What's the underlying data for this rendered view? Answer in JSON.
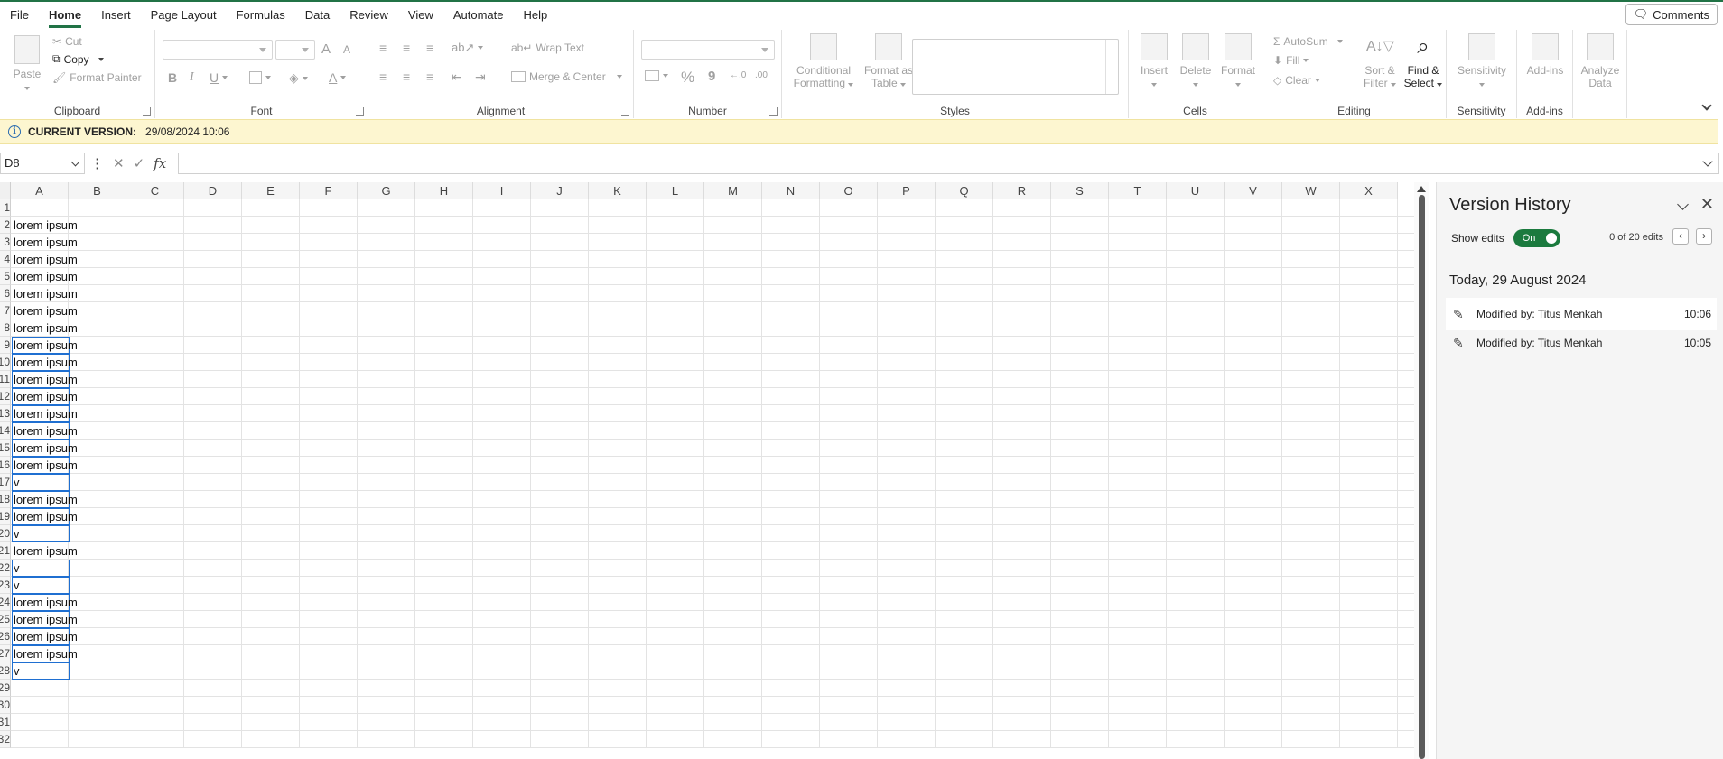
{
  "menu": {
    "tabs": [
      "File",
      "Home",
      "Insert",
      "Page Layout",
      "Formulas",
      "Data",
      "Review",
      "View",
      "Automate",
      "Help"
    ],
    "active": "Home",
    "comments_label": "Comments"
  },
  "ribbon": {
    "clipboard": {
      "paste": "Paste",
      "cut": "Cut",
      "copy": "Copy",
      "format_painter": "Format Painter",
      "label": "Clipboard"
    },
    "font": {
      "bold": "B",
      "italic": "I",
      "underline": "U",
      "grow": "A",
      "shrink": "A",
      "label": "Font"
    },
    "alignment": {
      "wrap_text": "Wrap Text",
      "merge_center": "Merge & Center",
      "label": "Alignment"
    },
    "number": {
      "percent": "%",
      "comma": "9",
      "label": "Number"
    },
    "styles": {
      "conditional": "Conditional",
      "formatting": "Formatting",
      "format_as": "Format as",
      "table": "Table",
      "label": "Styles"
    },
    "cells": {
      "insert": "Insert",
      "delete": "Delete",
      "format": "Format",
      "label": "Cells"
    },
    "editing": {
      "autosum": "AutoSum",
      "fill": "Fill",
      "clear": "Clear",
      "sort": "Sort &",
      "filter": "Filter",
      "find": "Find &",
      "select": "Select",
      "label": "Editing"
    },
    "sensitivity": {
      "button": "Sensitivity",
      "label": "Sensitivity"
    },
    "addins": {
      "button": "Add-ins",
      "label": "Add-ins"
    },
    "analyze": {
      "line1": "Analyze",
      "line2": "Data"
    }
  },
  "infobar": {
    "label": "CURRENT VERSION:",
    "value": "29/08/2024 10:06"
  },
  "formula_bar": {
    "name_box": "D8",
    "fx": "fx",
    "cancel": "✕",
    "enter": "✓"
  },
  "grid": {
    "columns": [
      "A",
      "B",
      "C",
      "D",
      "E",
      "F",
      "G",
      "H",
      "I",
      "J",
      "K",
      "L",
      "M",
      "N",
      "O",
      "P",
      "Q",
      "R",
      "S",
      "T",
      "U",
      "V",
      "W",
      "X"
    ],
    "rows": [
      {
        "n": "1",
        "a": "",
        "hl": false
      },
      {
        "n": "2",
        "a": "lorem ipsum",
        "hl": false
      },
      {
        "n": "3",
        "a": "lorem ipsum",
        "hl": false
      },
      {
        "n": "4",
        "a": "lorem ipsum",
        "hl": false
      },
      {
        "n": "5",
        "a": "lorem ipsum",
        "hl": false
      },
      {
        "n": "6",
        "a": "lorem ipsum",
        "hl": false
      },
      {
        "n": "7",
        "a": "lorem ipsum",
        "hl": false
      },
      {
        "n": "8",
        "a": "lorem ipsum",
        "hl": false
      },
      {
        "n": "9",
        "a": "lorem ipsum",
        "hl": true
      },
      {
        "n": "10",
        "a": "lorem ipsum",
        "hl": true
      },
      {
        "n": "11",
        "a": "lorem ipsum",
        "hl": true
      },
      {
        "n": "12",
        "a": "lorem ipsum",
        "hl": true
      },
      {
        "n": "13",
        "a": "lorem ipsum",
        "hl": true
      },
      {
        "n": "14",
        "a": "lorem ipsum",
        "hl": true
      },
      {
        "n": "15",
        "a": "lorem ipsum",
        "hl": true
      },
      {
        "n": "16",
        "a": "lorem ipsum",
        "hl": true
      },
      {
        "n": "17",
        "a": "v",
        "hl": true
      },
      {
        "n": "18",
        "a": "lorem ipsum",
        "hl": true
      },
      {
        "n": "19",
        "a": "lorem ipsum",
        "hl": true
      },
      {
        "n": "20",
        "a": "v",
        "hl": true
      },
      {
        "n": "21",
        "a": "lorem ipsum",
        "hl": false
      },
      {
        "n": "22",
        "a": "v",
        "hl": true
      },
      {
        "n": "23",
        "a": "v",
        "hl": true
      },
      {
        "n": "24",
        "a": "lorem ipsum",
        "hl": true
      },
      {
        "n": "25",
        "a": "lorem ipsum",
        "hl": true
      },
      {
        "n": "26",
        "a": "lorem ipsum",
        "hl": true
      },
      {
        "n": "27",
        "a": "lorem ipsum",
        "hl": true
      },
      {
        "n": "28",
        "a": "v",
        "hl": true
      },
      {
        "n": "29",
        "a": "",
        "hl": false
      },
      {
        "n": "30",
        "a": "",
        "hl": false
      },
      {
        "n": "31",
        "a": "",
        "hl": false
      },
      {
        "n": "32",
        "a": "",
        "hl": false
      }
    ]
  },
  "version_history": {
    "title": "Version History",
    "show_edits_label": "Show edits",
    "toggle_label": "On",
    "edit_count": "0 of 20 edits",
    "day": "Today, 29 August 2024",
    "items": [
      {
        "label": "Modified by: Titus Menkah",
        "time": "10:06",
        "selected": true
      },
      {
        "label": "Modified by: Titus Menkah",
        "time": "10:05",
        "selected": false
      }
    ]
  },
  "colors": {
    "accent": "#217346",
    "selection": "#1f6fd1",
    "toggle": "#1b7a3e",
    "infobar": "#fdf6d0"
  }
}
